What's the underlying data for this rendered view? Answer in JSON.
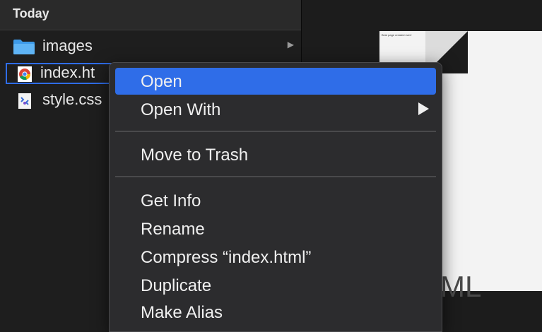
{
  "column": {
    "header": "Today",
    "items": [
      {
        "name": "images",
        "icon": "folder-icon"
      },
      {
        "name": "index.ht",
        "icon": "chrome-html-file-icon"
      },
      {
        "name": "style.css",
        "icon": "css-file-icon"
      }
    ]
  },
  "preview": {
    "page_text": "Best page created ever!",
    "file_type": "HTML"
  },
  "context_menu": {
    "items": [
      {
        "label": "Open",
        "selected": true
      },
      {
        "label": "Open With",
        "submenu": true
      },
      {
        "label": "Move to Trash"
      },
      {
        "label": "Get Info"
      },
      {
        "label": "Rename"
      },
      {
        "label": "Compress “index.html”"
      },
      {
        "label": "Duplicate"
      },
      {
        "label": "Make Alias"
      }
    ]
  },
  "colors": {
    "accent": "#2f6de8",
    "menu_bg": "#2c2c2e",
    "window_bg": "#1e1e1e"
  }
}
